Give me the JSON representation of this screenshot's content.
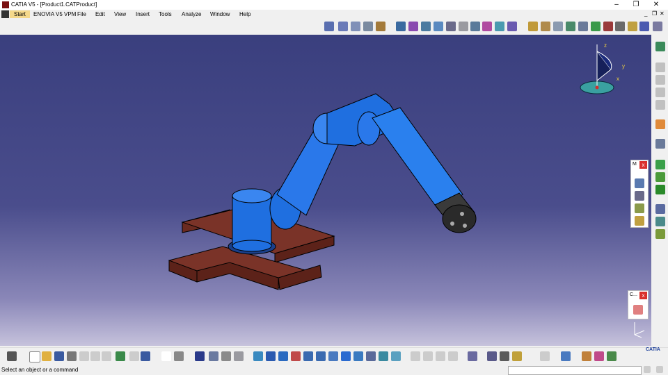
{
  "window": {
    "title": "CATIA V5 - [Product1.CATProduct]",
    "controls": {
      "minimize": "–",
      "restore": "❐",
      "close": "✕"
    },
    "mdi_controls": {
      "minimize": "_",
      "restore": "❐",
      "close": "✕"
    }
  },
  "menu": {
    "items": [
      "Start",
      "ENOVIA V5 VPM",
      "File",
      "Edit",
      "View",
      "Insert",
      "Tools",
      "Analyze",
      "Window",
      "Help"
    ]
  },
  "panels": {
    "m_panel_title": "M",
    "c_panel_title": "C..."
  },
  "compass": {
    "x": "x",
    "y": "y",
    "z": "z"
  },
  "status": {
    "message": "Select an object or a command",
    "command_value": ""
  },
  "brand": {
    "logo_text": "CATIA"
  },
  "colors": {
    "robot": "#1f6fe0",
    "base": "#7a3328",
    "background_top": "#3a3f7e",
    "background_bottom": "#c6c2dc"
  }
}
